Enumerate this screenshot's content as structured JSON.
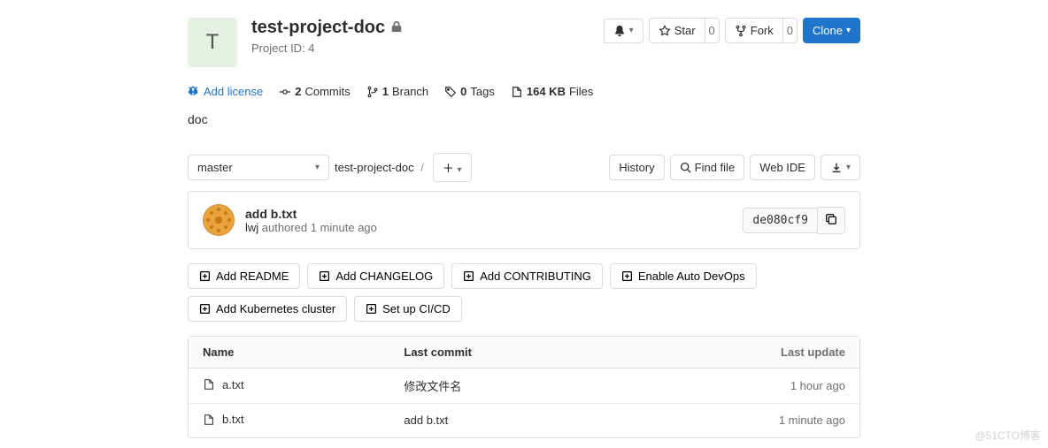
{
  "project": {
    "avatar_letter": "T",
    "name": "test-project-doc",
    "id_label": "Project ID: 4"
  },
  "actions": {
    "star_label": "Star",
    "star_count": "0",
    "fork_label": "Fork",
    "fork_count": "0",
    "clone_label": "Clone"
  },
  "stats": {
    "add_license": "Add license",
    "commits_count": "2",
    "commits_label": "Commits",
    "branches_count": "1",
    "branches_label": "Branch",
    "tags_count": "0",
    "tags_label": "Tags",
    "size_value": "164 KB",
    "size_label": "Files"
  },
  "description": "doc",
  "tree": {
    "branch": "master",
    "breadcrumb_root": "test-project-doc",
    "history_btn": "History",
    "findfile_btn": "Find file",
    "webide_btn": "Web IDE"
  },
  "last_commit": {
    "message": "add b.txt",
    "author": "lwj",
    "authored": "authored 1 minute ago",
    "sha": "de080cf9"
  },
  "setup": [
    "Add README",
    "Add CHANGELOG",
    "Add CONTRIBUTING",
    "Enable Auto DevOps",
    "Add Kubernetes cluster",
    "Set up CI/CD"
  ],
  "table": {
    "col_name": "Name",
    "col_commit": "Last commit",
    "col_update": "Last update",
    "rows": [
      {
        "name": "a.txt",
        "commit": "修改文件名",
        "time": "1 hour ago"
      },
      {
        "name": "b.txt",
        "commit": "add b.txt",
        "time": "1 minute ago"
      }
    ]
  },
  "watermark": "@51CTO博客"
}
